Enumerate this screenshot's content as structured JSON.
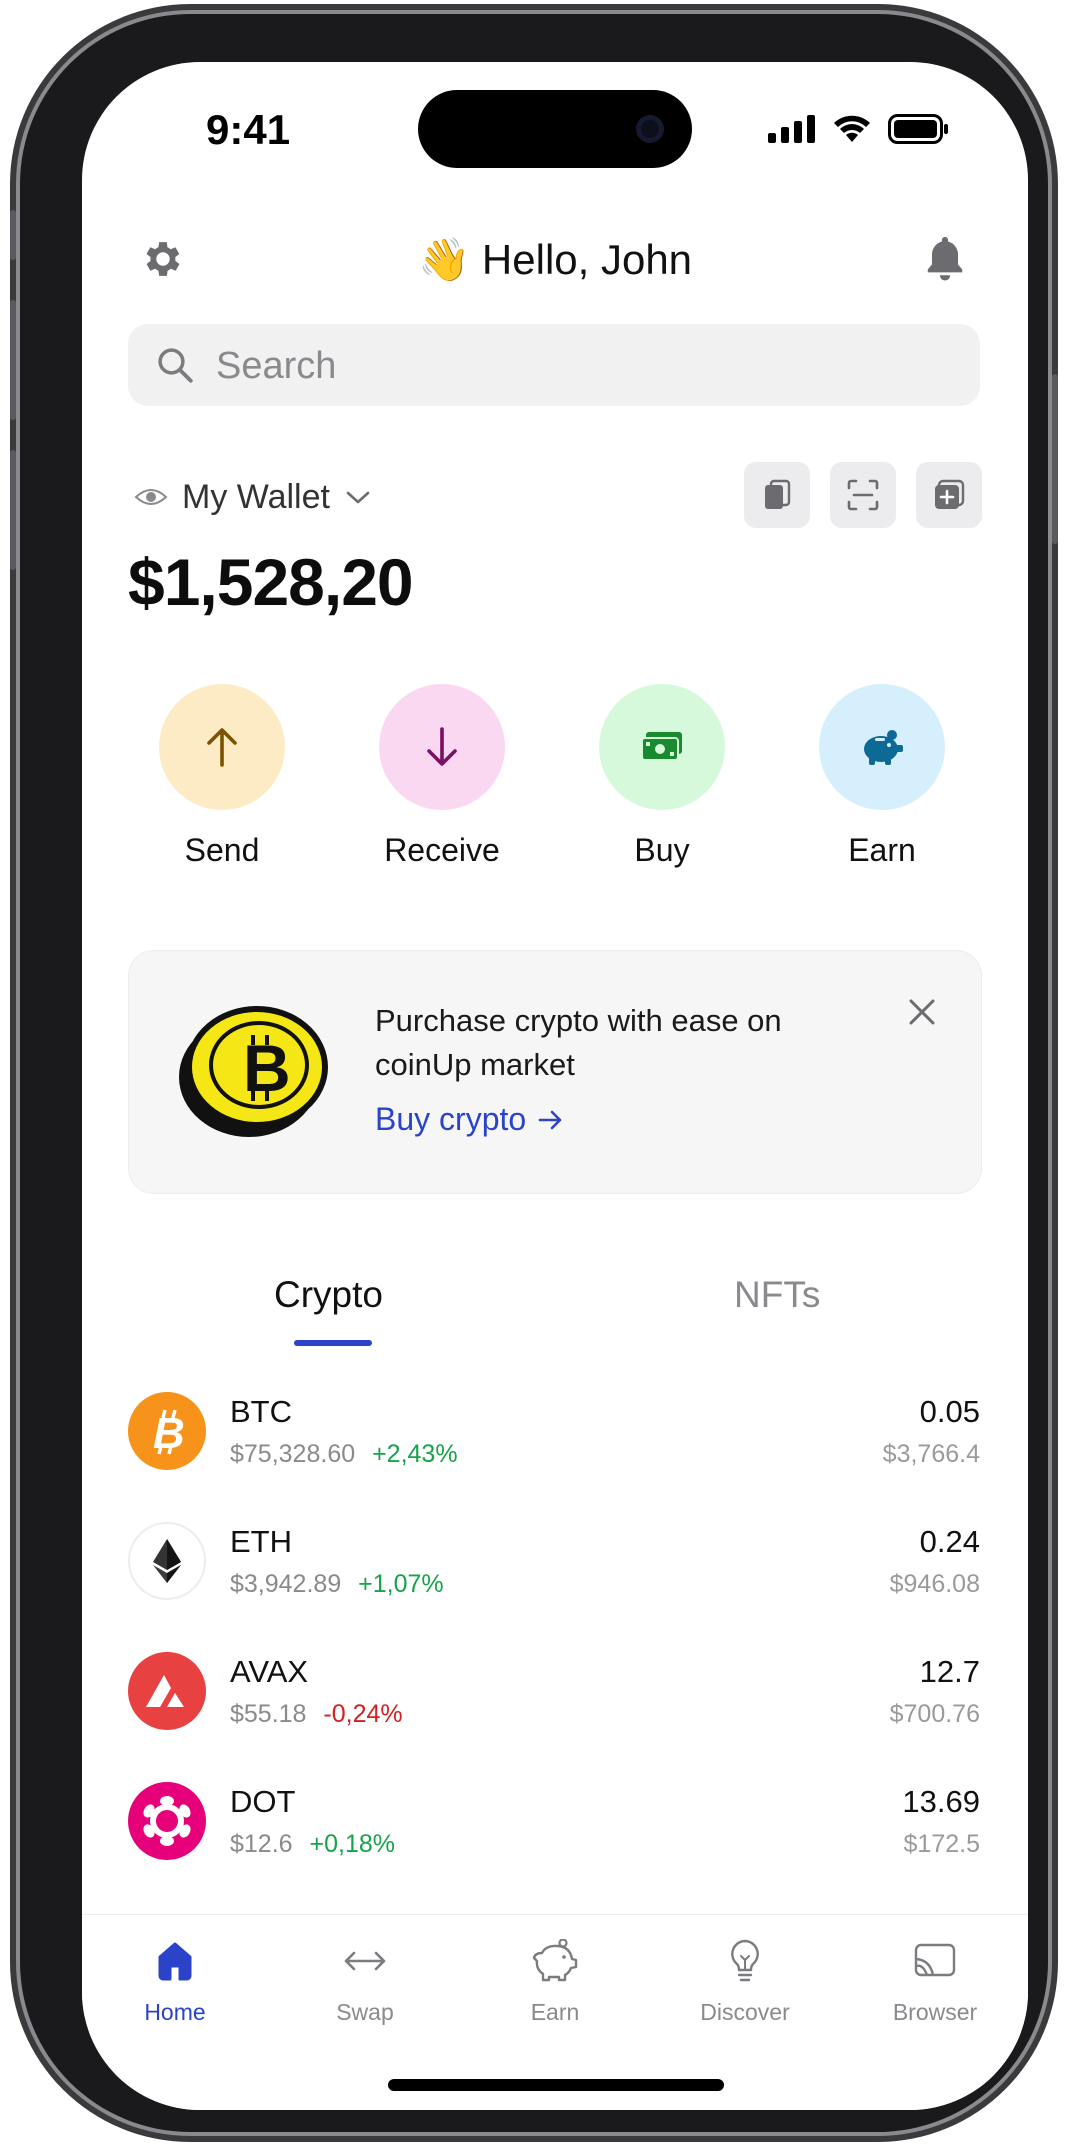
{
  "status_bar": {
    "time": "9:41"
  },
  "header": {
    "greeting_emoji": "👋",
    "greeting": "Hello, John"
  },
  "search": {
    "placeholder": "Search"
  },
  "wallet": {
    "name": "My Wallet",
    "balance": "$1,528,20"
  },
  "actions": [
    {
      "label": "Send",
      "icon": "arrow-up-icon",
      "color": "#fdebc5"
    },
    {
      "label": "Receive",
      "icon": "arrow-down-icon",
      "color": "#fbd8f2"
    },
    {
      "label": "Buy",
      "icon": "cash-icon",
      "color": "#d6f9dc"
    },
    {
      "label": "Earn",
      "icon": "piggy-bank-icon",
      "color": "#d6effd"
    }
  ],
  "promo": {
    "text": "Purchase crypto with ease on coinUp market",
    "link_label": "Buy crypto"
  },
  "tabs": {
    "crypto": "Crypto",
    "nfts": "NFTs",
    "active": "crypto"
  },
  "assets": [
    {
      "symbol": "BTC",
      "price": "$75,328.60",
      "change": "+2,43%",
      "trend": "up",
      "amount": "0.05",
      "value": "$3,766.4",
      "color": "#f7931a"
    },
    {
      "symbol": "ETH",
      "price": "$3,942.89",
      "change": "+1,07%",
      "trend": "up",
      "amount": "0.24",
      "value": "$946.08",
      "color": "#ffffff"
    },
    {
      "symbol": "AVAX",
      "price": "$55.18",
      "change": "-0,24%",
      "trend": "down",
      "amount": "12.7",
      "value": "$700.76",
      "color": "#e84142"
    },
    {
      "symbol": "DOT",
      "price": "$12.6",
      "change": "+0,18%",
      "trend": "up",
      "amount": "13.69",
      "value": "$172.5",
      "color": "#e6007a"
    }
  ],
  "nav": [
    {
      "label": "Home",
      "icon": "home-icon",
      "active": true
    },
    {
      "label": "Swap",
      "icon": "swap-icon",
      "active": false
    },
    {
      "label": "Earn",
      "icon": "piggy-bank-icon",
      "active": false
    },
    {
      "label": "Discover",
      "icon": "lightbulb-icon",
      "active": false
    },
    {
      "label": "Browser",
      "icon": "browser-icon",
      "active": false
    }
  ],
  "colors": {
    "accent": "#2a43c9",
    "positive": "#17a34a",
    "negative": "#d42020"
  }
}
